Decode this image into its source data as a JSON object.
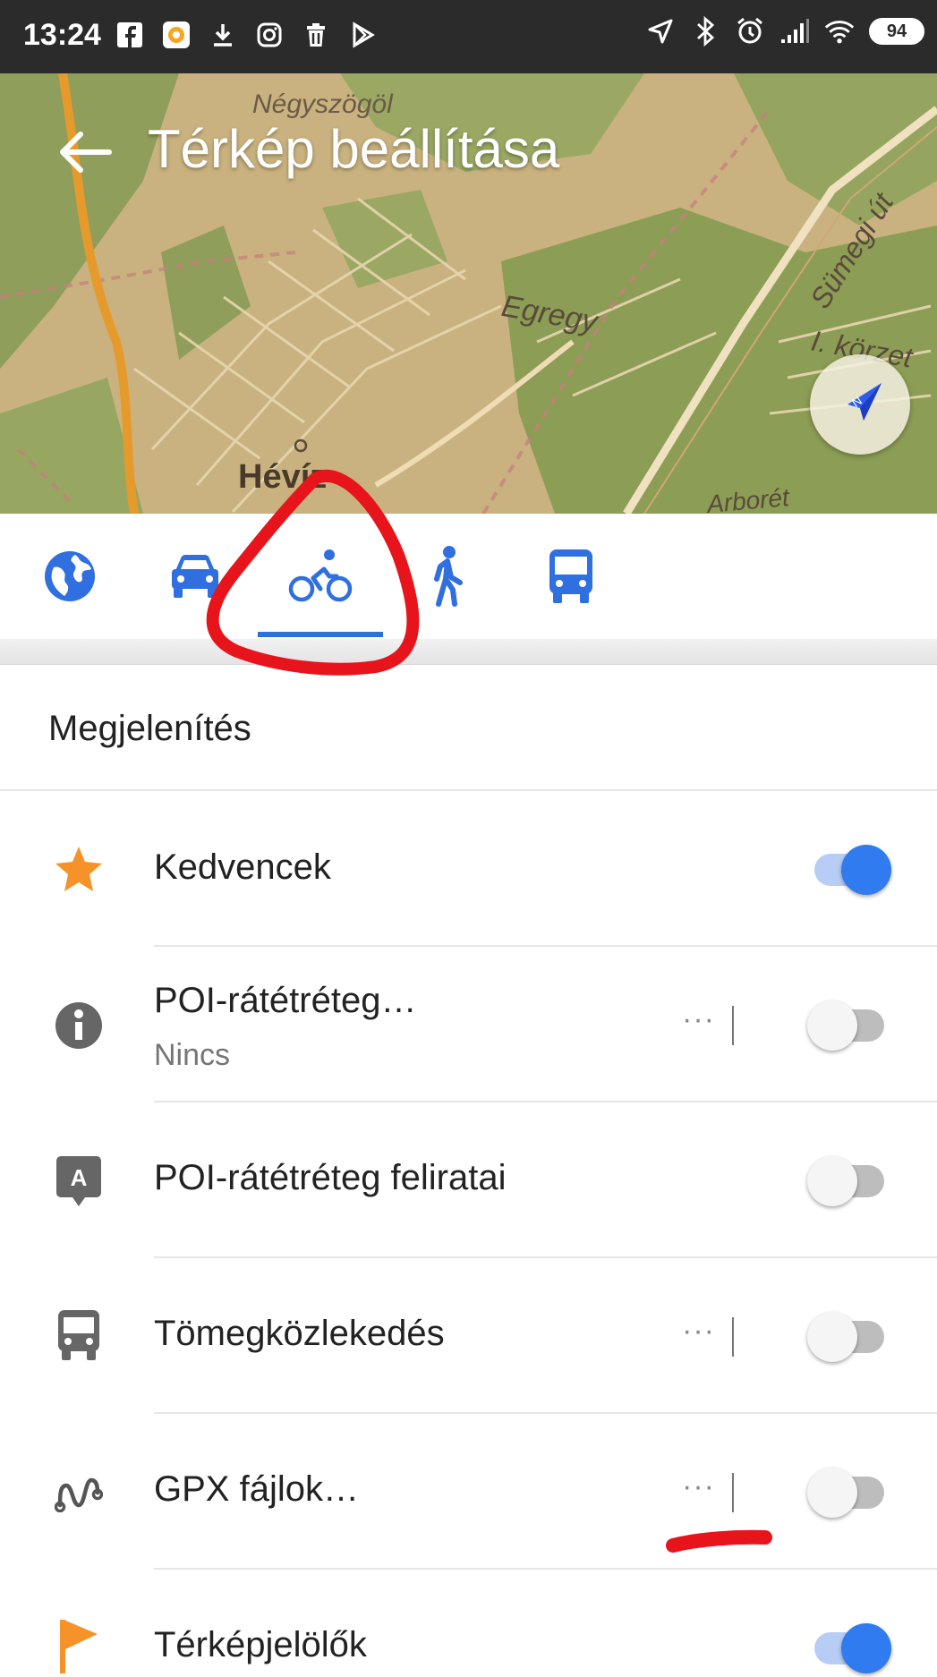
{
  "status_bar": {
    "time": "13:24",
    "battery": "94",
    "left_icons": [
      "facebook-icon",
      "app-icon",
      "download-icon",
      "instagram-icon",
      "trash-icon",
      "play-store-icon"
    ],
    "right_icons": [
      "location-icon",
      "bluetooth-icon",
      "alarm-icon",
      "signal-icon",
      "wifi-icon",
      "battery-icon"
    ]
  },
  "header": {
    "title": "Térkép beállítása",
    "map_labels": {
      "negyszog": "Négyszögöl",
      "egregy": "Egregy",
      "sumegi": "Sümegi út",
      "korzet": "I. körzet",
      "heviz": "Hévíz",
      "arbor": "Arborét"
    }
  },
  "tabs": [
    {
      "name": "globe-icon",
      "selected": false
    },
    {
      "name": "car-icon",
      "selected": false
    },
    {
      "name": "bicycle-icon",
      "selected": true
    },
    {
      "name": "walk-icon",
      "selected": false
    },
    {
      "name": "bus-icon",
      "selected": false
    }
  ],
  "section": {
    "title": "Megjelenítés"
  },
  "items": [
    {
      "label": "Kedvencek",
      "subtitle": "",
      "has_more": false,
      "on": true,
      "icon": "star-icon"
    },
    {
      "label": "POI-rátétréteg…",
      "subtitle": "Nincs",
      "has_more": true,
      "on": false,
      "icon": "info-icon"
    },
    {
      "label": "POI-rátétréteg feliratai",
      "subtitle": "",
      "has_more": false,
      "on": false,
      "icon": "label-icon"
    },
    {
      "label": "Tömegközlekedés",
      "subtitle": "",
      "has_more": true,
      "on": false,
      "icon": "bus-icon"
    },
    {
      "label": "GPX fájlok…",
      "subtitle": "",
      "has_more": true,
      "on": false,
      "icon": "route-icon"
    },
    {
      "label": "Térképjelölők",
      "subtitle": "",
      "has_more": false,
      "on": true,
      "icon": "flag-icon"
    }
  ],
  "more_glyph": "···",
  "label_icon_letter": "A",
  "colors": {
    "accent": "#2f7bef",
    "star": "#f5922a",
    "flag": "#f5922a",
    "annotation": "#e8141c"
  }
}
